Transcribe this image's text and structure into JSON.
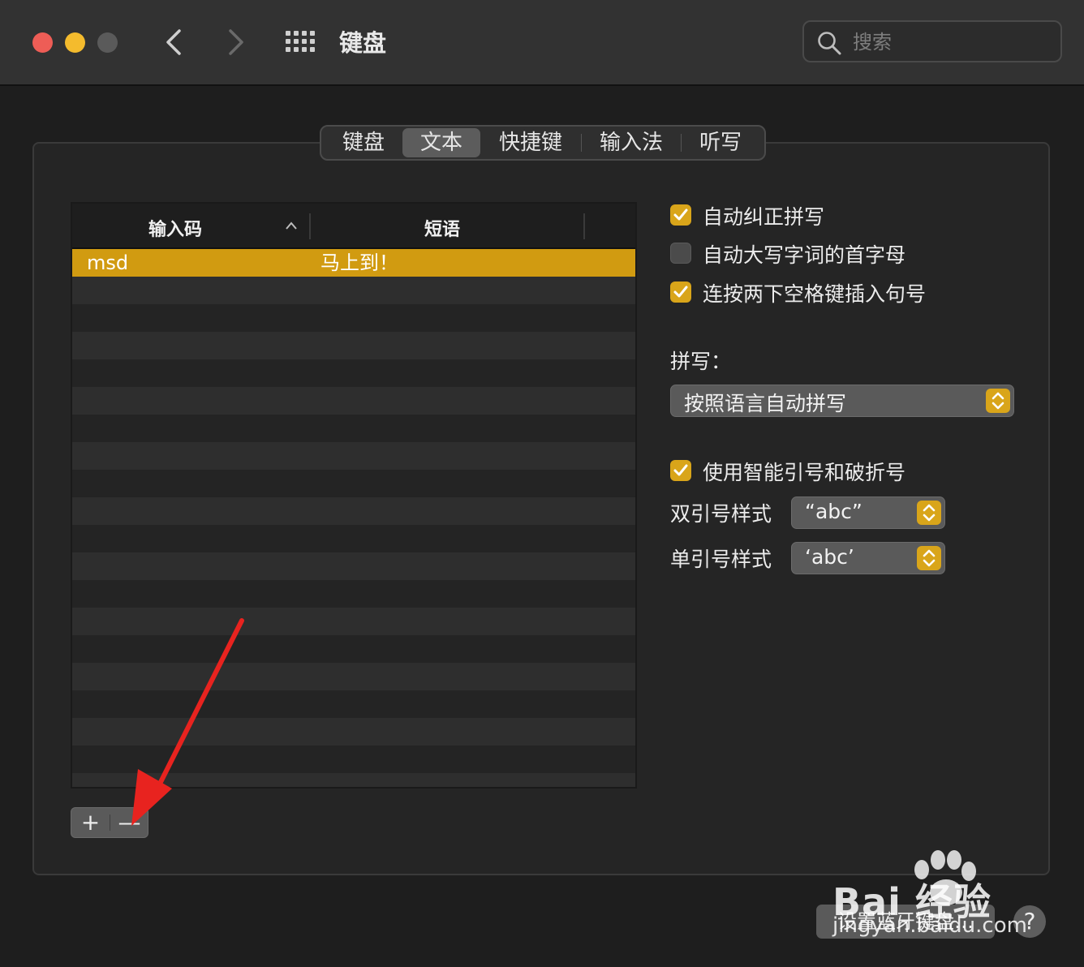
{
  "window": {
    "title": "键盘"
  },
  "search": {
    "placeholder": "搜索"
  },
  "tabs": [
    {
      "label": "键盘",
      "active": false
    },
    {
      "label": "文本",
      "active": true
    },
    {
      "label": "快捷键",
      "active": false
    },
    {
      "label": "输入法",
      "active": false
    },
    {
      "label": "听写",
      "active": false
    }
  ],
  "table": {
    "columns": [
      "输入码",
      "短语"
    ],
    "rows": [
      {
        "input": "msd",
        "phrase": "马上到！",
        "selected": true
      }
    ]
  },
  "toolbar": {
    "add_label": "+",
    "remove_label": "—"
  },
  "options": {
    "auto_correct": {
      "label": "自动纠正拼写",
      "checked": true
    },
    "auto_capitalize": {
      "label": "自动大写字词的首字母",
      "checked": false
    },
    "double_space_period": {
      "label": "连按两下空格键插入句号",
      "checked": true
    },
    "spelling_label": "拼写：",
    "spelling_value": "按照语言自动拼写",
    "smart_quotes": {
      "label": "使用智能引号和破折号",
      "checked": true
    },
    "double_quote_label": "双引号样式",
    "double_quote_value": "“abc”",
    "single_quote_label": "单引号样式",
    "single_quote_value": "‘abc’"
  },
  "footer": {
    "bluetooth_label": "设置蓝牙键盘…",
    "help_label": "?"
  },
  "watermark": {
    "brand": "Bai 经验",
    "url": "jingyan.baidu.com"
  },
  "colors": {
    "accent": "#d9a51a",
    "selection": "#d19b11",
    "annotation_arrow": "#e8231f"
  }
}
